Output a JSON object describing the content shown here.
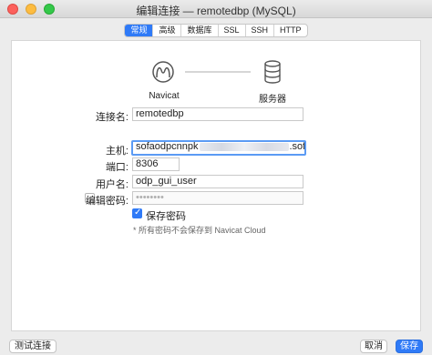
{
  "window": {
    "title": "编辑连接 — remotedbp (MySQL)"
  },
  "tabs": [
    {
      "label": "常规",
      "active": true
    },
    {
      "label": "高级",
      "active": false
    },
    {
      "label": "数据库",
      "active": false
    },
    {
      "label": "SSL",
      "active": false
    },
    {
      "label": "SSH",
      "active": false
    },
    {
      "label": "HTTP",
      "active": false
    }
  ],
  "diagram": {
    "left_label": "Navicat",
    "right_label": "服务器",
    "left_icon": "navicat-logo-icon",
    "right_icon": "database-icon"
  },
  "form": {
    "connection_name_label": "连接名:",
    "connection_name_value": "remotedbp",
    "host_label": "主机:",
    "host_value_prefix": "sofaodpcnnpk",
    "host_value_suffix": ".sofaodp.aliyuncs.",
    "port_label": "端口:",
    "port_value": "8306",
    "username_label": "用户名:",
    "username_value": "odp_gui_user",
    "password_label": "编辑密码:",
    "password_value": "••••••••",
    "save_password_label": "保存密码",
    "save_password_checked": true,
    "hint": "* 所有密码不会保存到 Navicat Cloud"
  },
  "buttons": {
    "test": "测试连接",
    "cancel": "取消",
    "save": "保存"
  },
  "colors": {
    "accent": "#2f7af7",
    "focus": "#5b9bf4"
  }
}
